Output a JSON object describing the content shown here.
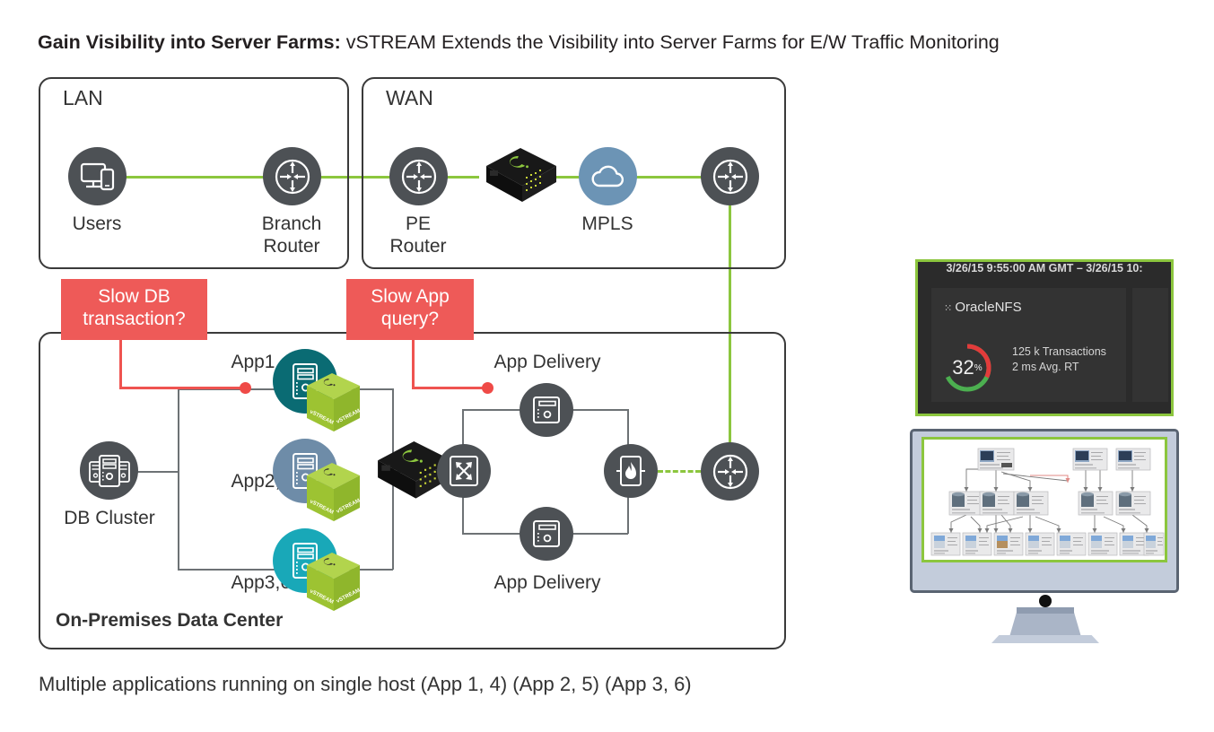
{
  "title": {
    "bold": "Gain Visibility into Server Farms:",
    "rest": " vSTREAM Extends the Visibility into Server Farms for E/W Traffic Monitoring"
  },
  "zones": {
    "lan": "LAN",
    "wan": "WAN",
    "datacenter": "On-Premises Data Center"
  },
  "nodes": {
    "users": "Users",
    "branch_router": "Branch\nRouter",
    "branch_router_l1": "Branch",
    "branch_router_l2": "Router",
    "pe_router_l1": "PE",
    "pe_router_l2": "Router",
    "mpls": "MPLS",
    "db_cluster": "DB Cluster",
    "app14": "App1,4",
    "app25": "App2,5",
    "app36": "App3,6",
    "app_delivery_top": "App Delivery",
    "app_delivery_bottom": "App Delivery"
  },
  "callouts": {
    "db_l1": "Slow DB",
    "db_l2": "transaction?",
    "app_l1": "Slow App",
    "app_l2": "query?"
  },
  "cube_label": "vSTREAM",
  "dashboard": {
    "time_range": "3/26/15 9:55:00 AM GMT – 3/26/15 10:",
    "app_name": "OracleNFS",
    "gauge_value": "32",
    "gauge_unit": "%",
    "metric_1": "125 k Transactions",
    "metric_2": "2 ms Avg. RT",
    "gauge_green_pct": 68,
    "gauge_red_pct": 32
  },
  "caption": "Multiple applications running on single host  (App 1, 4)  (App 2, 5)  (App 3, 6)",
  "colors": {
    "green_link": "#8cc63e",
    "red_callout": "#ee5a58",
    "node_gray": "#4d5155",
    "app14": "#0a6b73",
    "app25": "#6e8ca8",
    "app36": "#19a8b8",
    "mpls_blue": "#6c94b5",
    "cube_green": "#a5c93f",
    "gauge_green": "#4caf50",
    "gauge_red": "#e23b3b"
  }
}
